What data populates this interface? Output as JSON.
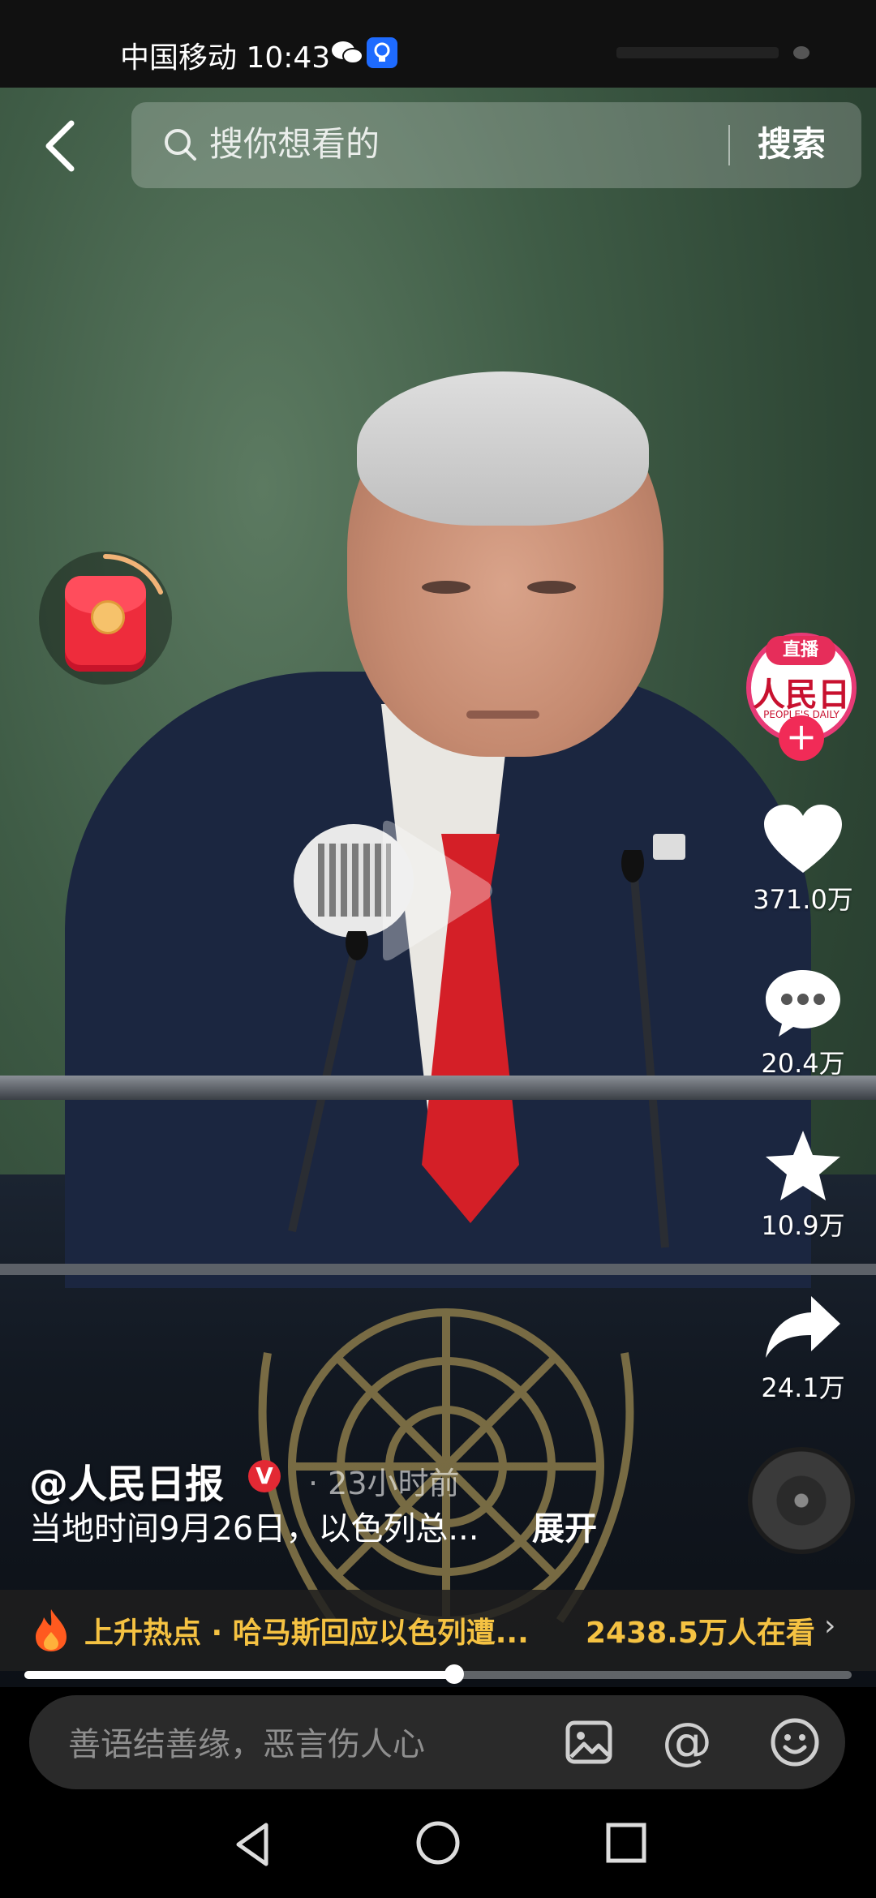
{
  "status_bar": {
    "carrier_time": "中国移动 10:43"
  },
  "search": {
    "placeholder": "搜你想看的",
    "button": "搜索"
  },
  "creator": {
    "live_badge": "直播",
    "logo_text": "人民日报",
    "logo_sub": "PEOPLE'S DAILY"
  },
  "actions": {
    "likes": "371.0万",
    "comments": "20.4万",
    "favorites": "10.9万",
    "shares": "24.1万"
  },
  "post": {
    "author": "@人民日报",
    "verified": "V",
    "time": "· 23小时前",
    "caption": "当地时间9月26日，以色列总...",
    "expand": "展开"
  },
  "hot": {
    "label": "上升热点 · 哈马斯回应以色列遭...",
    "viewers": "2438.5万人在看",
    "chevron": "›"
  },
  "playback": {
    "progress": 0.52
  },
  "comment_bar": {
    "placeholder": "善语结善缘，恶言伤人心",
    "at": "@"
  },
  "colors": {
    "accent_pink": "#e62d5a",
    "hot_yellow": "#f5c242",
    "verified_red": "#e32934"
  }
}
